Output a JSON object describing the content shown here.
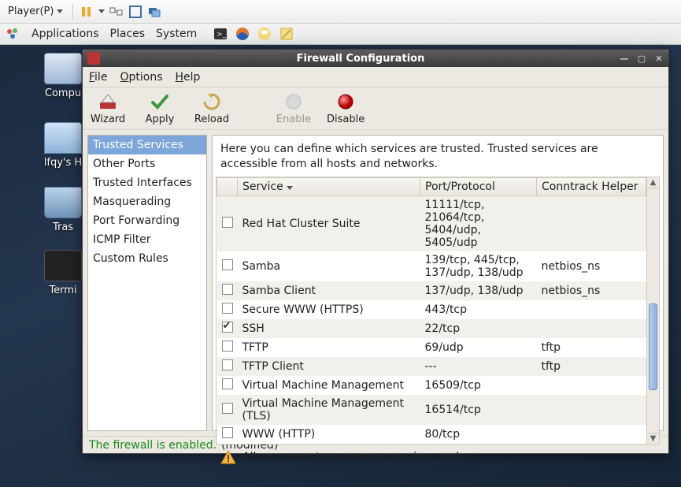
{
  "vmware": {
    "player_label": "Player(P)"
  },
  "gnome": {
    "menus": {
      "applications": "Applications",
      "places": "Places",
      "system": "System"
    }
  },
  "desktop_icons": {
    "computer": "Compu",
    "home": "lfqy's H",
    "trash": "Tras",
    "terminal": "Termi"
  },
  "window": {
    "title": "Firewall Configuration",
    "menubar": {
      "file": "File",
      "options": "Options",
      "help": "Help"
    },
    "toolbar": {
      "wizard": "Wizard",
      "apply": "Apply",
      "reload": "Reload",
      "enable": "Enable",
      "disable": "Disable"
    },
    "sidebar": {
      "items": [
        "Trusted Services",
        "Other Ports",
        "Trusted Interfaces",
        "Masquerading",
        "Port Forwarding",
        "ICMP Filter",
        "Custom Rules"
      ],
      "selected_index": 0
    },
    "main": {
      "description": "Here you can define which services are trusted. Trusted services are accessible from all hosts and networks.",
      "columns": {
        "service": "Service",
        "port": "Port/Protocol",
        "helper": "Conntrack Helper"
      },
      "rows": [
        {
          "checked": false,
          "service": "Red Hat Cluster Suite",
          "port": "11111/tcp, 21064/tcp, 5404/udp, 5405/udp",
          "helper": ""
        },
        {
          "checked": false,
          "service": "Samba",
          "port": "139/tcp, 445/tcp, 137/udp, 138/udp",
          "helper": "netbios_ns"
        },
        {
          "checked": false,
          "service": "Samba Client",
          "port": "137/udp, 138/udp",
          "helper": "netbios_ns"
        },
        {
          "checked": false,
          "service": "Secure WWW (HTTPS)",
          "port": "443/tcp",
          "helper": ""
        },
        {
          "checked": true,
          "service": "SSH",
          "port": "22/tcp",
          "helper": ""
        },
        {
          "checked": false,
          "service": "TFTP",
          "port": "69/udp",
          "helper": "tftp"
        },
        {
          "checked": false,
          "service": "TFTP Client",
          "port": "---",
          "helper": "tftp"
        },
        {
          "checked": false,
          "service": "Virtual Machine Management",
          "port": "16509/tcp",
          "helper": ""
        },
        {
          "checked": false,
          "service": "Virtual Machine Management (TLS)",
          "port": "16514/tcp",
          "helper": ""
        },
        {
          "checked": false,
          "service": "WWW (HTTP)",
          "port": "80/tcp",
          "helper": ""
        }
      ],
      "hint": "Allow access to necessary services, only."
    },
    "status": {
      "enabled": "The firewall is enabled.",
      "modified": "(modified)"
    }
  }
}
